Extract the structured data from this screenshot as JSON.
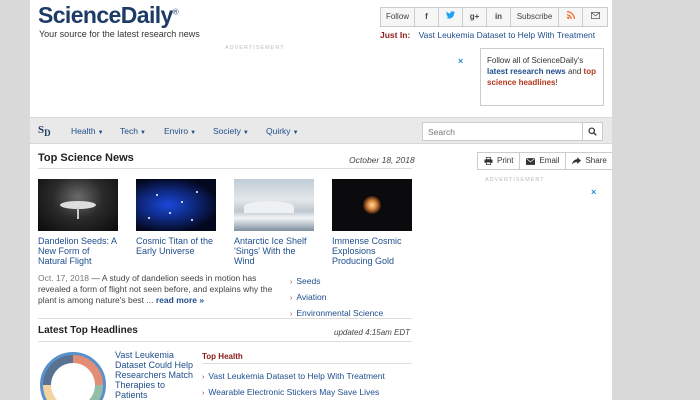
{
  "header": {
    "logo": "ScienceDaily",
    "logo_mark": "®",
    "tagline": "Your source for the latest research news",
    "follow_label": "Follow",
    "subscribe_label": "Subscribe",
    "social_icons": [
      "facebook-icon",
      "twitter-icon",
      "googleplus-icon",
      "linkedin-icon",
      "rss-icon",
      "email-icon"
    ],
    "just_in_label": "Just In:",
    "just_in_link": "Vast Leukemia Dataset to Help With Treatment"
  },
  "ads": {
    "label": "ADVERTISEMENT",
    "close": "×"
  },
  "follow_box": {
    "text_1": "Follow all of ScienceDaily's",
    "link_1": "latest research news",
    "text_2": "and",
    "link_2": "top science headlines",
    "text_3": "!"
  },
  "nav": {
    "logo_s": "S",
    "logo_d": "D",
    "items": [
      "Health",
      "Tech",
      "Enviro",
      "Society",
      "Quirky"
    ],
    "search_placeholder": "Search"
  },
  "top_news": {
    "title": "Top Science News",
    "date": "October 18, 2018",
    "stories": [
      {
        "headline": "Dandelion Seeds: A New Form of Natural Flight"
      },
      {
        "headline": "Cosmic Titan of the Early Universe"
      },
      {
        "headline": "Antarctic Ice Shelf 'Sings' With the Wind"
      },
      {
        "headline": "Immense Cosmic Explosions Producing Gold"
      }
    ],
    "summary_date": "Oct. 17, 2018",
    "summary_dash": "—",
    "summary_text": "A study of dandelion seeds in motion has revealed a form of flight not seen before, and explains why the plant is among nature's best ...",
    "read_more": "read more »",
    "tags": [
      "Seeds",
      "Aviation",
      "Environmental Science"
    ]
  },
  "headlines": {
    "title": "Latest Top Headlines",
    "updated": "updated 4:15am EDT",
    "lead_story": "Vast Leukemia Dataset Could Help Researchers Match Therapies to Patients",
    "top_health_label": "Top Health",
    "items": [
      "Vast Leukemia Dataset to Help With Treatment",
      "Wearable Electronic Stickers May Save Lives"
    ]
  },
  "tools": {
    "print": "Print",
    "email": "Email",
    "share": "Share"
  },
  "colors": {
    "brand": "#1e3a66",
    "link": "#1f4e8c",
    "accent": "#b5371b",
    "just_in": "#8b1a1a",
    "ad_close": "#2a8fd6"
  }
}
